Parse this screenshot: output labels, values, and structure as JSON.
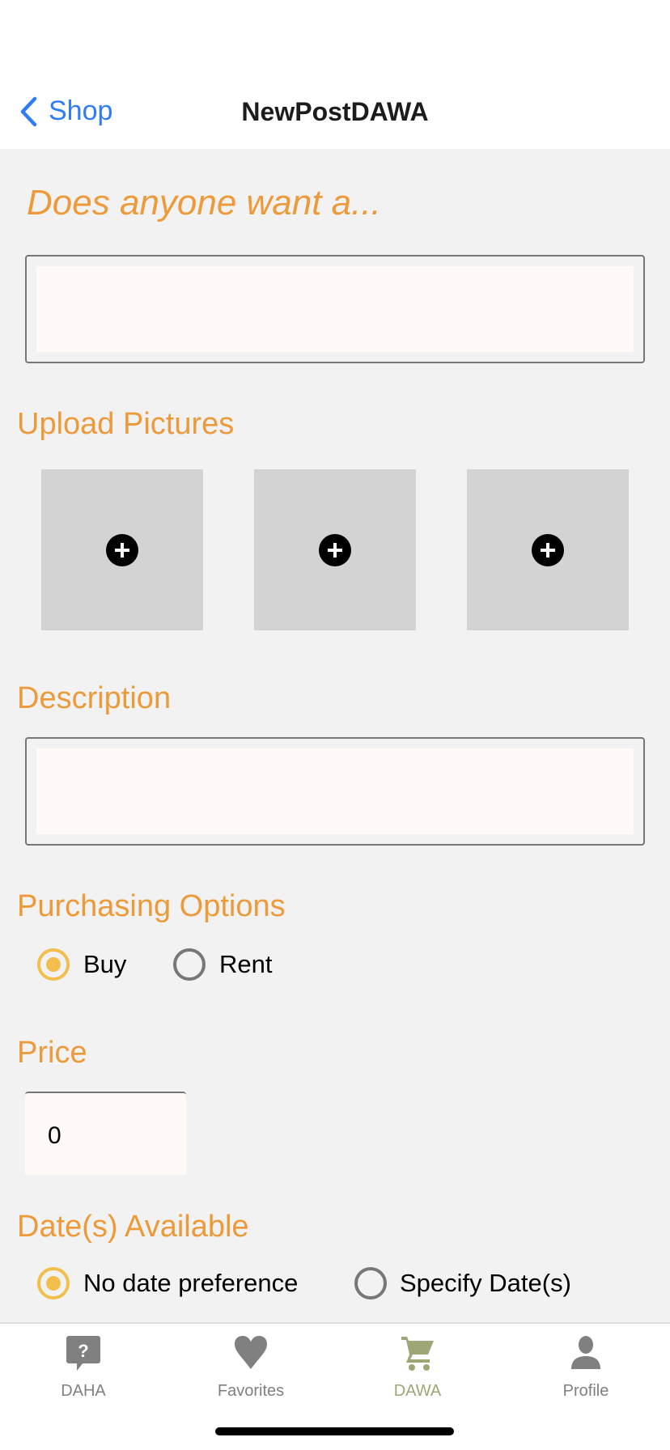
{
  "nav": {
    "back_label": "Shop",
    "title": "NewPostDAWA"
  },
  "form": {
    "heading": "Does anyone want a...",
    "title_input": {
      "value": "",
      "placeholder": ""
    },
    "upload_label": "Upload Pictures",
    "picture_slots": 3,
    "description_label": "Description",
    "description_input": {
      "value": "",
      "placeholder": ""
    },
    "purchasing_label": "Purchasing Options",
    "purchasing_options": [
      {
        "label": "Buy",
        "selected": true
      },
      {
        "label": "Rent",
        "selected": false
      }
    ],
    "price_label": "Price",
    "price_value": "0",
    "dates_label": "Date(s) Available",
    "date_options": [
      {
        "label": "No date preference",
        "selected": true
      },
      {
        "label": "Specify Date(s)",
        "selected": false
      }
    ]
  },
  "tabs": [
    {
      "label": "DAHA",
      "icon": "question-bubble-icon",
      "active": false
    },
    {
      "label": "Favorites",
      "icon": "heart-icon",
      "active": false
    },
    {
      "label": "DAWA",
      "icon": "cart-icon",
      "active": true
    },
    {
      "label": "Profile",
      "icon": "person-icon",
      "active": false
    }
  ],
  "colors": {
    "accent": "#ec9a3a",
    "radio_selected": "#f2bf4c",
    "active_tab": "#9ea676",
    "link": "#2f7cf6"
  }
}
